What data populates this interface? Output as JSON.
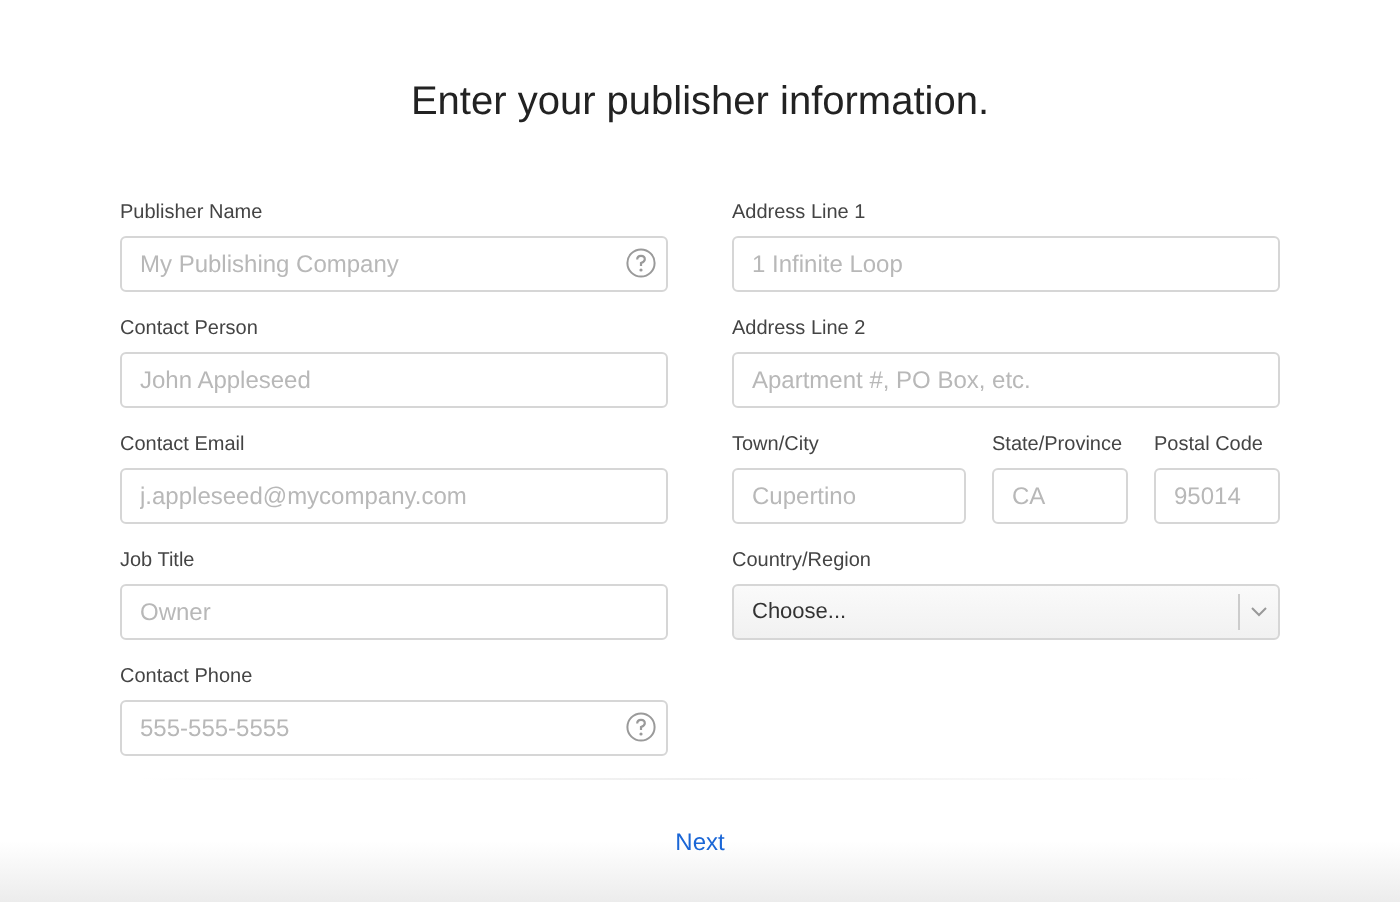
{
  "title": "Enter your publisher information.",
  "left_fields": [
    {
      "kind": "text",
      "label": "Publisher Name",
      "placeholder": "My Publishing Company",
      "help": true
    },
    {
      "kind": "text",
      "label": "Contact Person",
      "placeholder": "John Appleseed",
      "help": false
    },
    {
      "kind": "text",
      "label": "Contact Email",
      "placeholder": "j.appleseed@mycompany.com",
      "help": false
    },
    {
      "kind": "text",
      "label": "Job Title",
      "placeholder": "Owner",
      "help": false
    },
    {
      "kind": "text",
      "label": "Contact Phone",
      "placeholder": "555-555-5555",
      "help": true
    }
  ],
  "right_rows": [
    [
      {
        "kind": "text",
        "label": "Address Line 1",
        "placeholder": "1 Infinite Loop",
        "help": false
      }
    ],
    [
      {
        "kind": "text",
        "label": "Address Line 2",
        "placeholder": "Apartment #, PO Box, etc.",
        "help": false
      }
    ],
    [
      {
        "kind": "text",
        "label": "Town/City",
        "placeholder": "Cupertino",
        "help": false
      },
      {
        "kind": "text",
        "label": "State/Province",
        "placeholder": "CA",
        "help": false
      },
      {
        "kind": "text",
        "label": "Postal Code",
        "placeholder": "95014",
        "help": false
      }
    ],
    [
      {
        "kind": "select",
        "label": "Country/Region",
        "value": "Choose..."
      }
    ]
  ],
  "next_button": "Next"
}
